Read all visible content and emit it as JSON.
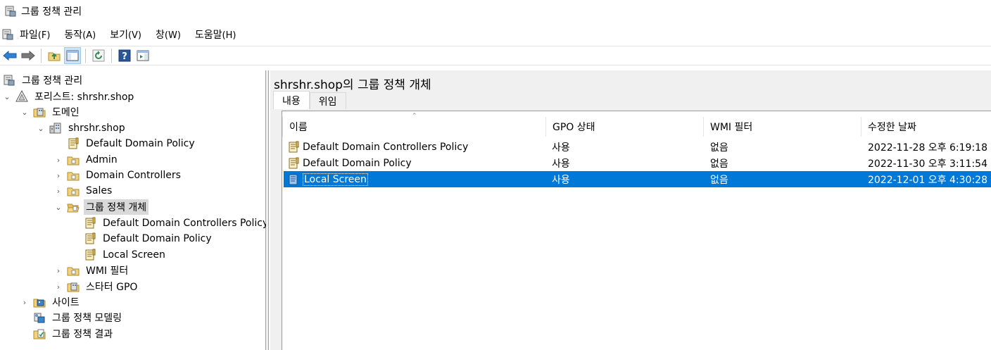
{
  "window": {
    "title": "그룹 정책 관리"
  },
  "menu": [
    {
      "label": "파일",
      "key": "(F)"
    },
    {
      "label": "동작",
      "key": "(A)"
    },
    {
      "label": "보기",
      "key": "(V)"
    },
    {
      "label": "창",
      "key": "(W)"
    },
    {
      "label": "도움말",
      "key": "(H)"
    }
  ],
  "tree": {
    "root": "그룹 정책 관리",
    "forest": "포리스트: shrshr.shop",
    "domains": "도메인",
    "domain": "shrshr.shop",
    "ddp": "Default Domain Policy",
    "admin": "Admin",
    "dc": "Domain Controllers",
    "sales": "Sales",
    "gpo_container": "그룹 정책 개체",
    "gpo1": "Default Domain Controllers Policy",
    "gpo2": "Default Domain Policy",
    "gpo3": "Local Screen",
    "wmi": "WMI 필터",
    "starter": "스타터 GPO",
    "sites": "사이트",
    "modeling": "그룹 정책 모델링",
    "results": "그룹 정책 결과"
  },
  "content": {
    "title": "shrshr.shop의 그룹 정책 개체",
    "tabs": [
      "내용",
      "위임"
    ],
    "columns": [
      "이름",
      "GPO 상태",
      "WMI 필터",
      "수정한 날짜"
    ],
    "rows": [
      {
        "name": "Default Domain Controllers Policy",
        "status": "사용",
        "wmi": "없음",
        "modified": "2022-11-28 오후 6:19:18"
      },
      {
        "name": "Default Domain Policy",
        "status": "사용",
        "wmi": "없음",
        "modified": "2022-11-30 오후 3:11:54"
      },
      {
        "name": "Local Screen",
        "status": "사용",
        "wmi": "없음",
        "modified": "2022-12-01 오후 4:30:28"
      }
    ]
  },
  "colors": {
    "selection": "#0078d7",
    "tree_selection": "#d9d9d9",
    "gpo_icon": "#c9a44c"
  }
}
